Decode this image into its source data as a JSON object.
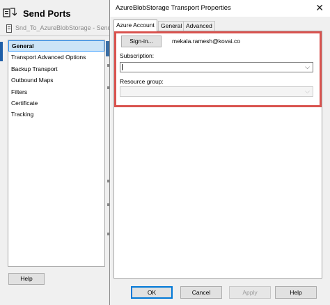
{
  "back_window": {
    "title": "Send Ports",
    "subtitle": "Snd_To_AzureBlobStorage - Send",
    "nav_items": [
      {
        "label": "General",
        "selected": true
      },
      {
        "label": "Transport Advanced Options",
        "selected": false
      },
      {
        "label": "Backup Transport",
        "selected": false
      },
      {
        "label": "Outbound Maps",
        "selected": false
      },
      {
        "label": "Filters",
        "selected": false
      },
      {
        "label": "Certificate",
        "selected": false
      },
      {
        "label": "Tracking",
        "selected": false
      }
    ],
    "help_label": "Help"
  },
  "dialog": {
    "title": "AzureBlobStorage Transport Properties",
    "close_glyph": "✕",
    "tabs": [
      {
        "label": "Azure Account",
        "active": true
      },
      {
        "label": "General",
        "active": false
      },
      {
        "label": "Advanced",
        "active": false
      }
    ],
    "signin_label": "Sign-in...",
    "account_name": "mekala.ramesh@kovai.co",
    "subscription": {
      "label": "Subscription:",
      "value": ""
    },
    "resource_group": {
      "label": "Resource group:",
      "value": "",
      "disabled": true
    },
    "buttons": {
      "ok": "OK",
      "cancel": "Cancel",
      "apply": "Apply",
      "help": "Help"
    }
  },
  "colors": {
    "highlight": "#d9534f",
    "selection": "#cce4f7",
    "accent": "#0078d7"
  },
  "icons": [
    "send-ports-icon",
    "send-port-icon",
    "close-icon",
    "chevron-down-icon"
  ]
}
